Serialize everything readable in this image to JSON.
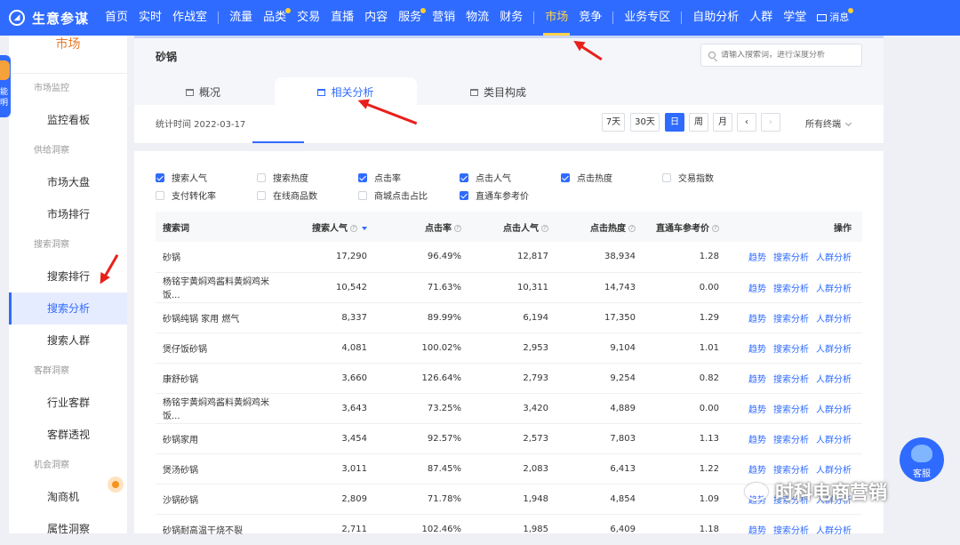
{
  "nav": {
    "brand": "生意参谋",
    "group1": [
      "首页",
      "实时",
      "作战室"
    ],
    "group2": [
      "流量",
      "品类",
      "交易",
      "直播",
      "内容",
      "服务",
      "营销",
      "物流",
      "财务"
    ],
    "active": "市场",
    "compete": "竞争",
    "business": "业务专区",
    "group4": [
      "自助分析",
      "人群",
      "学堂"
    ],
    "message": "消息"
  },
  "sidebar": {
    "title": "市场",
    "mascot_text": "能明",
    "groups": [
      {
        "label": "市场监控",
        "items": [
          "监控看板"
        ]
      },
      {
        "label": "供给洞察",
        "items": [
          "市场大盘",
          "市场排行"
        ]
      },
      {
        "label": "搜索洞察",
        "items": [
          "搜索排行",
          "搜索分析",
          "搜索人群"
        ]
      },
      {
        "label": "客群洞察",
        "items": [
          "行业客群",
          "客群透视"
        ]
      },
      {
        "label": "机会洞察",
        "items": [
          "淘商机",
          "属性洞察"
        ]
      }
    ],
    "active_item": "搜索分析"
  },
  "header": {
    "keyword": "砂锅",
    "search_placeholder": "请输入搜索词，进行深度分析",
    "tabs": [
      "概况",
      "相关分析",
      "类目构成"
    ]
  },
  "toolbar": {
    "stat_time": "统计时间 2022-03-17",
    "periods": [
      "7天",
      "30天",
      "日",
      "周",
      "月"
    ],
    "active_period": "日",
    "prev": "‹",
    "next": "›",
    "terminal": "所有终端"
  },
  "filters": [
    {
      "label": "搜索人气",
      "checked": true
    },
    {
      "label": "搜索热度",
      "checked": false
    },
    {
      "label": "点击率",
      "checked": true
    },
    {
      "label": "点击人气",
      "checked": true
    },
    {
      "label": "点击热度",
      "checked": true
    },
    {
      "label": "交易指数",
      "checked": false
    },
    {
      "label": "支付转化率",
      "checked": false
    },
    {
      "label": "在线商品数",
      "checked": false
    },
    {
      "label": "商城点击占比",
      "checked": false
    },
    {
      "label": "直通车参考价",
      "checked": true
    }
  ],
  "table": {
    "headers": [
      "搜索词",
      "搜索人气",
      "点击率",
      "点击人气",
      "点击热度",
      "直通车参考价",
      "操作"
    ],
    "ops": [
      "趋势",
      "搜索分析",
      "人群分析"
    ],
    "rows": [
      [
        "砂锅",
        "17,290",
        "96.49%",
        "12,817",
        "38,934",
        "1.28"
      ],
      [
        "杨铭宇黄焖鸡酱料黄焖鸡米饭...",
        "10,542",
        "71.63%",
        "10,311",
        "14,743",
        "0.00"
      ],
      [
        "砂锅纯锅 家用 燃气",
        "8,337",
        "89.99%",
        "6,194",
        "17,350",
        "1.29"
      ],
      [
        "煲仔饭砂锅",
        "4,081",
        "100.02%",
        "2,953",
        "9,104",
        "1.01"
      ],
      [
        "康舒砂锅",
        "3,660",
        "126.64%",
        "2,793",
        "9,254",
        "0.82"
      ],
      [
        "杨铭宇黄焖鸡酱料黄焖鸡米饭...",
        "3,643",
        "73.25%",
        "3,420",
        "4,889",
        "0.00"
      ],
      [
        "砂锅家用",
        "3,454",
        "92.57%",
        "2,573",
        "7,803",
        "1.13"
      ],
      [
        "煲汤砂锅",
        "3,011",
        "87.45%",
        "2,083",
        "6,413",
        "1.22"
      ],
      [
        "沙锅砂锅",
        "2,809",
        "71.78%",
        "1,948",
        "4,854",
        "1.09"
      ],
      [
        "砂锅耐高温干烧不裂",
        "2,711",
        "102.46%",
        "1,985",
        "6,409",
        "1.18"
      ]
    ]
  },
  "service_label": "客服",
  "watermark": "时科电商营销",
  "colors": {
    "brand": "#2f6bff",
    "active_nav": "#ffd24a",
    "arrow": "#e8201b"
  }
}
